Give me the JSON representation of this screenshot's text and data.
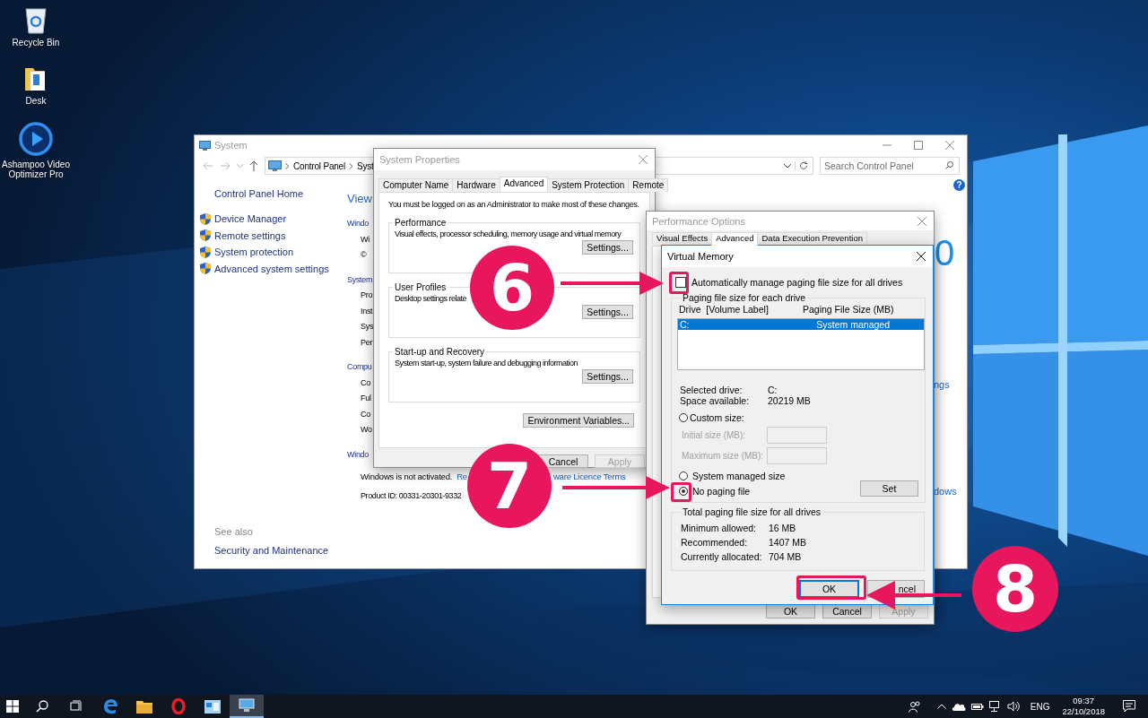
{
  "desktop": {
    "icons": [
      {
        "label": "Recycle Bin",
        "kind": "recycle"
      },
      {
        "label": "Desk",
        "kind": "folder"
      },
      {
        "label": "Ashampoo Video Optimizer Pro",
        "kind": "player"
      }
    ]
  },
  "system_window": {
    "title": "System",
    "address": [
      "Control Panel",
      "Syst"
    ],
    "search": {
      "placeholder": "Search Control Panel"
    },
    "help": "?",
    "sidebar": {
      "home": "Control Panel Home",
      "links": [
        "Device Manager",
        "Remote settings",
        "System protection",
        "Advanced system settings"
      ],
      "see_also": "See also",
      "see_also_links": [
        "Security and Maintenance"
      ]
    },
    "heading": "View",
    "lines": [
      {
        "kind": "section",
        "text": "Windo"
      },
      {
        "kind": "item",
        "text": "Wi"
      },
      {
        "kind": "item",
        "text": "©"
      },
      {
        "kind": "section",
        "text": "System"
      },
      {
        "kind": "item",
        "text": "Pro"
      },
      {
        "kind": "item",
        "text": "Inst"
      },
      {
        "kind": "item",
        "text": "Sys"
      },
      {
        "kind": "item",
        "text": "Per"
      },
      {
        "kind": "section",
        "text": "Compu"
      },
      {
        "kind": "item",
        "text": "Co"
      },
      {
        "kind": "item",
        "text": "Ful"
      },
      {
        "kind": "item",
        "text": "Co"
      },
      {
        "kind": "item",
        "text": "Wo"
      },
      {
        "kind": "section",
        "text": "Windo"
      },
      {
        "kind": "activation",
        "text": "Windows is not activated.",
        "links": [
          "Re",
          "ware Licence Terms"
        ]
      },
      {
        "kind": "detail",
        "text": "Product ID: 00331-20301-9332"
      }
    ],
    "right": {
      "logo_fragment": "0",
      "links": [
        "ngs",
        "dows"
      ]
    }
  },
  "system_properties": {
    "title": "System Properties",
    "tabs": [
      {
        "label": "Computer Name",
        "selected": false
      },
      {
        "label": "Hardware",
        "selected": false
      },
      {
        "label": "Advanced",
        "selected": true
      },
      {
        "label": "System Protection",
        "selected": false
      },
      {
        "label": "Remote",
        "selected": false
      }
    ],
    "notice": "You must be logged on as an Administrator to make most of these changes.",
    "groups": [
      {
        "title": "Performance",
        "text": "Visual effects, processor scheduling, memory usage and virtual memory",
        "button": "Settings..."
      },
      {
        "title": "User Profiles",
        "text": "Desktop settings relate",
        "button": "Settings..."
      },
      {
        "title": "Start-up and Recovery",
        "text": "System start-up, system failure and debugging information",
        "button": "Settings..."
      }
    ],
    "env_button": "Environment Variables...",
    "buttons": [
      {
        "label": "Cancel",
        "disabled": false
      },
      {
        "label": "Apply",
        "disabled": true
      }
    ]
  },
  "performance_options": {
    "title": "Performance Options",
    "tabs": [
      {
        "label": "Visual Effects",
        "selected": false
      },
      {
        "label": "Advanced",
        "selected": true
      },
      {
        "label": "Data Execution Prevention",
        "selected": false
      }
    ],
    "buttons": [
      {
        "label": "OK",
        "disabled": false
      },
      {
        "label": "Cancel",
        "disabled": false
      },
      {
        "label": "Apply",
        "disabled": true
      }
    ]
  },
  "virtual_memory": {
    "title": "Virtual Memory",
    "auto_manage": {
      "label": "Automatically manage paging file size for all drives",
      "checked": false
    },
    "drives_group": "Paging file size for each drive",
    "columns": [
      "Drive  [Volume Label]",
      "Paging File Size (MB)"
    ],
    "drives": [
      {
        "drive": "C:",
        "size": "System managed",
        "selected": true
      }
    ],
    "info": [
      {
        "label": "Selected drive:",
        "value": "C:"
      },
      {
        "label": "Space available:",
        "value": "20219 MB"
      }
    ],
    "options": [
      {
        "label": "Custom size:",
        "selected": false
      },
      {
        "label": "System managed size",
        "selected": false
      },
      {
        "label": "No paging file",
        "selected": true
      }
    ],
    "fields": [
      {
        "label": "Initial size (MB):",
        "disabled": true
      },
      {
        "label": "Maximum size (MB):",
        "disabled": true
      }
    ],
    "set_button": "Set",
    "totals": {
      "title": "Total paging file size for all drives",
      "rows": [
        {
          "label": "Minimum allowed:",
          "value": "16 MB"
        },
        {
          "label": "Recommended:",
          "value": "1407 MB"
        },
        {
          "label": "Currently allocated:",
          "value": "704 MB"
        }
      ]
    },
    "buttons": [
      {
        "label": "OK",
        "focused": true
      },
      {
        "label": "ncel",
        "focused": false
      }
    ]
  },
  "annotations": [
    {
      "label": "6"
    },
    {
      "label": "7"
    },
    {
      "label": "8"
    }
  ],
  "taskbar": {
    "apps": [
      {
        "kind": "taskview",
        "selected": false
      },
      {
        "kind": "edge",
        "selected": false
      },
      {
        "kind": "explorer",
        "selected": false
      },
      {
        "kind": "opera",
        "selected": false
      },
      {
        "kind": "control",
        "selected": false
      },
      {
        "kind": "system",
        "selected": true
      }
    ],
    "language": "ENG",
    "time": "09:37",
    "date": "22/10/2018"
  }
}
